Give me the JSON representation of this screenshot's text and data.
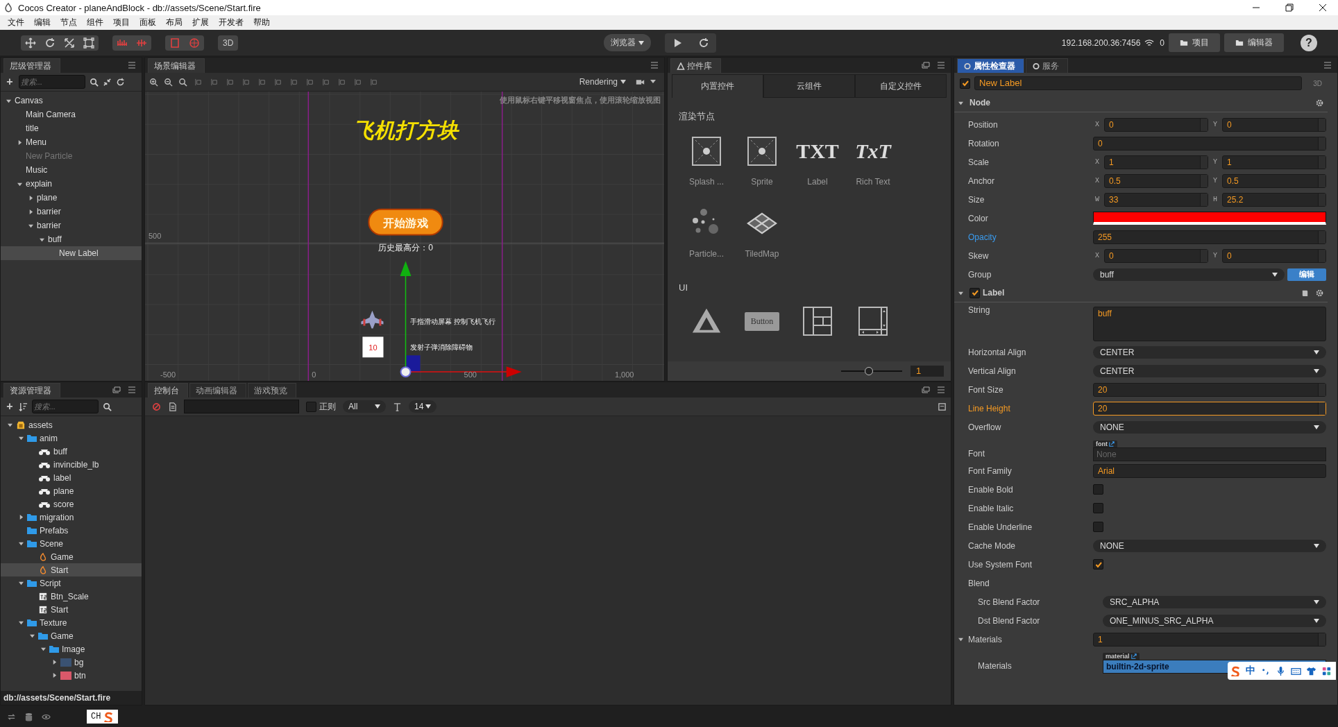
{
  "window": {
    "title": "Cocos Creator - planeAndBlock - db://assets/Scene/Start.fire"
  },
  "menu": [
    "文件",
    "编辑",
    "节点",
    "组件",
    "项目",
    "面板",
    "布局",
    "扩展",
    "开发者",
    "帮助"
  ],
  "toolbar": {
    "mode_3d": "3D",
    "preview_target": "浏览器",
    "address": "192.168.200.36:7456",
    "connections": "0",
    "project_button": "项目",
    "editor_button": "编辑器",
    "help": "?"
  },
  "hierarchy": {
    "title": "层级管理器",
    "add": "+",
    "search": {
      "placeholder": "搜索..."
    },
    "tree": [
      {
        "name": "Canvas",
        "expanded": true,
        "selected": false,
        "disabled": false,
        "children": [
          {
            "name": "Main Camera",
            "selected": false,
            "disabled": false
          },
          {
            "name": "title",
            "selected": false,
            "disabled": false
          },
          {
            "name": "Menu",
            "expanded": false,
            "selected": false,
            "disabled": false
          },
          {
            "name": "New Particle",
            "selected": false,
            "disabled": true
          },
          {
            "name": "Music",
            "selected": false,
            "disabled": false
          },
          {
            "name": "explain",
            "expanded": true,
            "selected": false,
            "disabled": false,
            "children": [
              {
                "name": "plane",
                "expanded": false,
                "selected": false,
                "disabled": false
              },
              {
                "name": "barrier",
                "expanded": false,
                "selected": false,
                "disabled": false
              },
              {
                "name": "barrier",
                "expanded": true,
                "selected": false,
                "disabled": false,
                "children": [
                  {
                    "name": "buff",
                    "expanded": true,
                    "selected": false,
                    "disabled": false,
                    "children": [
                      {
                        "name": "New Label",
                        "selected": true,
                        "disabled": false
                      }
                    ]
                  }
                ]
              }
            ]
          }
        ]
      }
    ]
  },
  "scene": {
    "title": "场景编辑器",
    "render_mode": "Rendering",
    "hint": "使用鼠标右键平移视窗焦点，使用滚轮缩放视图",
    "game_title": "飞机打方块",
    "start_button": "开始游戏",
    "high_score": "历史最高分：0",
    "help_move": "手指滑动屏幕 控制飞机飞行",
    "bullet_count": "10",
    "help_shoot": "发射子弹消除障碍物",
    "y_labels": [
      "500"
    ],
    "x_labels": [
      "-500",
      "0",
      "500",
      "1,000"
    ]
  },
  "library": {
    "title": "控件库",
    "tabs": [
      {
        "label": "内置控件",
        "selected": true
      },
      {
        "label": "云组件",
        "selected": false
      },
      {
        "label": "自定义控件",
        "selected": false
      }
    ],
    "groups": [
      {
        "title": "渲染节点",
        "items": [
          {
            "kind": "sprite",
            "label": "Splash ..."
          },
          {
            "kind": "sprite",
            "label": "Sprite"
          },
          {
            "kind": "text",
            "glyph": "TXT",
            "label": "Label"
          },
          {
            "kind": "richtext",
            "glyph": "TxT",
            "label": "Rich Text"
          },
          {
            "kind": "particle",
            "label": "Particle..."
          },
          {
            "kind": "tiledmap",
            "label": "TiledMap"
          }
        ]
      },
      {
        "title": "UI",
        "items": [
          {
            "kind": "canvas"
          },
          {
            "kind": "button",
            "glyph": "Button"
          },
          {
            "kind": "layout"
          },
          {
            "kind": "scrollview"
          }
        ]
      }
    ],
    "zoom": {
      "level": 0.45,
      "value": "1"
    }
  },
  "assets": {
    "title": "资源管理器",
    "add": "+",
    "search": {
      "placeholder": "搜索..."
    },
    "path": "db://assets/Scene/Start.fire",
    "tree": [
      {
        "name": "assets",
        "kind": "root",
        "expanded": true,
        "selected": false,
        "children": [
          {
            "name": "anim",
            "kind": "folder",
            "expanded": true,
            "selected": false,
            "children": [
              {
                "name": "buff",
                "kind": "anim",
                "selected": false
              },
              {
                "name": "invincible_lb",
                "kind": "anim",
                "selected": false
              },
              {
                "name": "label",
                "kind": "anim",
                "selected": false
              },
              {
                "name": "plane",
                "kind": "anim",
                "selected": false
              },
              {
                "name": "score",
                "kind": "anim",
                "selected": false
              }
            ]
          },
          {
            "name": "migration",
            "kind": "folder",
            "expanded": false,
            "selected": false
          },
          {
            "name": "Prefabs",
            "kind": "folder",
            "selected": false
          },
          {
            "name": "Scene",
            "kind": "folder",
            "expanded": true,
            "selected": false,
            "children": [
              {
                "name": "Game",
                "kind": "scene",
                "selected": false
              },
              {
                "name": "Start",
                "kind": "scene",
                "selected": true
              }
            ]
          },
          {
            "name": "Script",
            "kind": "folder",
            "expanded": true,
            "selected": false,
            "children": [
              {
                "name": "Btn_Scale",
                "kind": "script",
                "selected": false
              },
              {
                "name": "Start",
                "kind": "script",
                "selected": false
              }
            ]
          },
          {
            "name": "Texture",
            "kind": "folder",
            "expanded": true,
            "selected": false,
            "children": [
              {
                "name": "Game",
                "kind": "folder",
                "expanded": true,
                "selected": false,
                "children": [
                  {
                    "name": "Image",
                    "kind": "folder",
                    "expanded": true,
                    "selected": false,
                    "children": [
                      {
                        "name": "bg",
                        "kind": "image",
                        "color": "#3a5272",
                        "expanded": false,
                        "selected": false
                      },
                      {
                        "name": "btn",
                        "kind": "image",
                        "color": "#d9586a",
                        "expanded": false,
                        "selected": false
                      }
                    ]
                  }
                ]
              }
            ]
          }
        ]
      }
    ]
  },
  "console": {
    "tabs": [
      {
        "label": "控制台",
        "selected": true
      },
      {
        "label": "动画编辑器",
        "selected": false
      },
      {
        "label": "游戏预览",
        "selected": false
      }
    ],
    "regex": {
      "label": "正则",
      "checked": false
    },
    "level_filter": "All",
    "font_size": "14"
  },
  "inspector": {
    "tabs": [
      {
        "label": "属性检查器",
        "selected": true
      },
      {
        "label": "服务",
        "selected": false
      }
    ],
    "node": {
      "active": true,
      "name": "New Label",
      "mode": "3D"
    },
    "sections": [
      {
        "title": "Node",
        "expanded": true,
        "props": [
          {
            "kind": "xy",
            "label": "Position",
            "a": "X",
            "av": "0",
            "b": "Y",
            "bv": "0"
          },
          {
            "kind": "number",
            "label": "Rotation",
            "value": "0"
          },
          {
            "kind": "xy",
            "label": "Scale",
            "a": "X",
            "av": "1",
            "b": "Y",
            "bv": "1"
          },
          {
            "kind": "xy",
            "label": "Anchor",
            "a": "X",
            "av": "0.5",
            "b": "Y",
            "bv": "0.5"
          },
          {
            "kind": "xy",
            "label": "Size",
            "a": "W",
            "av": "33",
            "b": "H",
            "bv": "25.2"
          },
          {
            "kind": "color",
            "label": "Color",
            "color": "#ff0000"
          },
          {
            "kind": "number",
            "label": "Opacity",
            "value": "255",
            "modified": true
          },
          {
            "kind": "xy",
            "label": "Skew",
            "a": "X",
            "av": "0",
            "b": "Y",
            "bv": "0"
          },
          {
            "kind": "select",
            "label": "Group",
            "value": "buff",
            "button": "编辑"
          }
        ]
      },
      {
        "title": "Label",
        "expanded": true,
        "enabled": true,
        "props": [
          {
            "kind": "textarea",
            "label": "String",
            "value": "buff"
          },
          {
            "kind": "select",
            "label": "Horizontal Align",
            "value": "CENTER"
          },
          {
            "kind": "select",
            "label": "Vertical Align",
            "value": "CENTER"
          },
          {
            "kind": "number",
            "label": "Font Size",
            "value": "20"
          },
          {
            "kind": "number",
            "label": "Line Height",
            "value": "20",
            "focused": true
          },
          {
            "kind": "select",
            "label": "Overflow",
            "value": "NONE"
          },
          {
            "kind": "asset",
            "label": "Font",
            "tag": "font",
            "placeholder": "None",
            "selected": false
          },
          {
            "kind": "text",
            "label": "Font Family",
            "value": "Arial"
          },
          {
            "kind": "checkbox",
            "label": "Enable Bold",
            "checked": false
          },
          {
            "kind": "checkbox",
            "label": "Enable Italic",
            "checked": false
          },
          {
            "kind": "checkbox",
            "label": "Enable Underline",
            "checked": false
          },
          {
            "kind": "select",
            "label": "Cache Mode",
            "value": "NONE"
          },
          {
            "kind": "checkbox",
            "label": "Use System Font",
            "checked": true
          },
          {
            "kind": "group",
            "label": "Blend",
            "children": [
              {
                "kind": "select",
                "label": "Src Blend Factor",
                "value": "SRC_ALPHA"
              },
              {
                "kind": "select",
                "label": "Dst Blend Factor",
                "value": "ONE_MINUS_SRC_ALPHA"
              }
            ]
          },
          {
            "kind": "array",
            "label": "Materials",
            "value": "1",
            "expanded": true,
            "children": [
              {
                "kind": "asset",
                "label": "Materials",
                "tag": "material",
                "value": "builtin-2d-sprite",
                "selected": true
              }
            ]
          }
        ]
      }
    ]
  },
  "ime_toolbar": {
    "mode": "中"
  },
  "status_bar": {
    "ime": "CH"
  }
}
